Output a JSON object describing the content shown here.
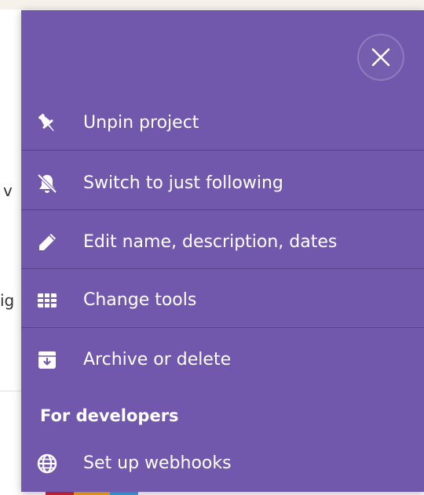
{
  "background": {
    "fragment_1": "v",
    "fragment_2": "ig"
  },
  "menu": {
    "close_label": "Close",
    "items": [
      {
        "label": "Unpin project",
        "icon": "pin-icon"
      },
      {
        "label": "Switch to just following",
        "icon": "bell-off-icon"
      },
      {
        "label": "Edit name, description, dates",
        "icon": "pencil-icon"
      },
      {
        "label": "Change tools",
        "icon": "grid-icon"
      },
      {
        "label": "Archive or delete",
        "icon": "archive-icon"
      }
    ],
    "developers_heading": "For developers",
    "developer_items": [
      {
        "label": "Set up webhooks",
        "icon": "globe-icon"
      }
    ]
  },
  "colors": {
    "menu_background": "#7158ac",
    "text": "#ffffff",
    "divider": "#5a4590"
  }
}
